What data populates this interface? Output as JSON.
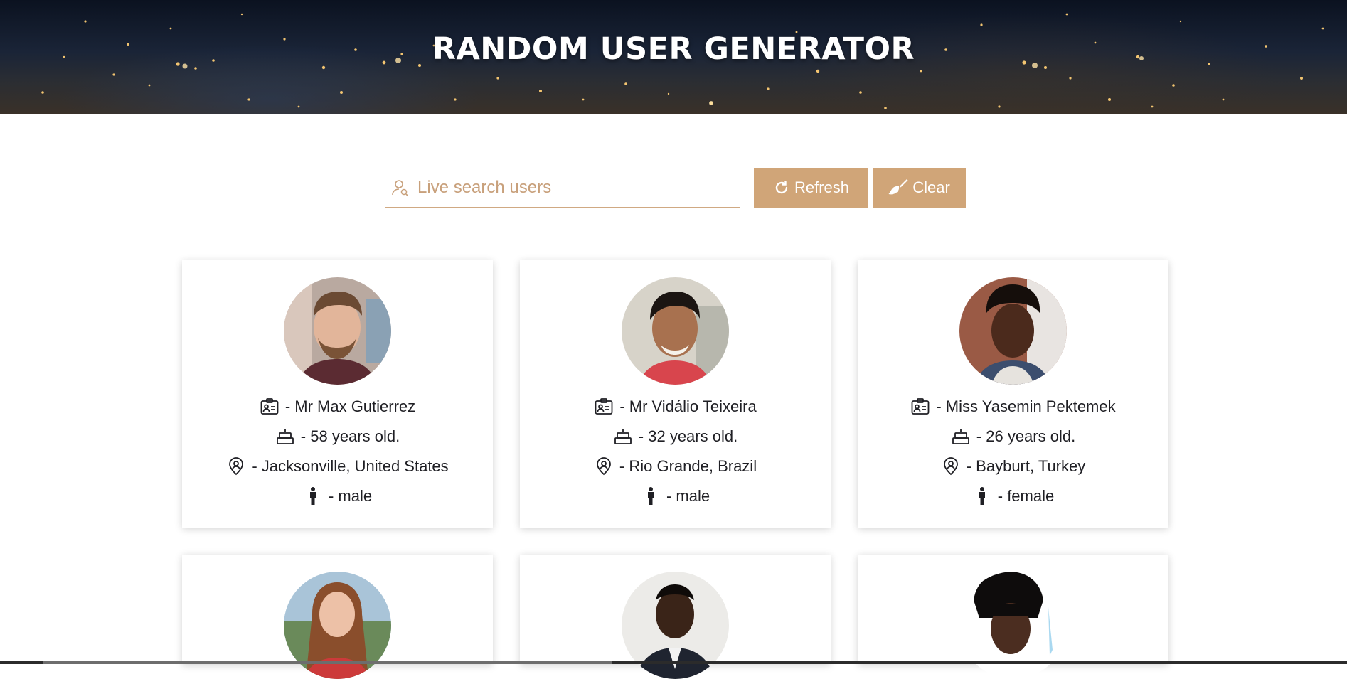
{
  "header": {
    "title": "RANDOM USER GENERATOR"
  },
  "search": {
    "placeholder": "Live search users",
    "value": ""
  },
  "buttons": {
    "refresh_label": "Refresh",
    "clear_label": "Clear"
  },
  "colors": {
    "accent": "#d0a578",
    "accent_text": "#c8a07b",
    "text": "#1f1f24"
  },
  "icons": {
    "name": "id-card-icon",
    "age": "cake-icon",
    "location": "map-pin-icon",
    "gender": "person-icon",
    "search": "user-search-icon",
    "refresh": "refresh-icon",
    "clear": "broom-icon"
  },
  "users": [
    {
      "name": "- Mr Max Gutierrez",
      "age": "- 58 years old.",
      "location": "- Jacksonville, United States",
      "gender": "- male"
    },
    {
      "name": "- Mr Vidálio Teixeira",
      "age": "- 32 years old.",
      "location": "- Rio Grande, Brazil",
      "gender": "- male"
    },
    {
      "name": "- Miss Yasemin Pektemek",
      "age": "- 26 years old.",
      "location": "- Bayburt, Turkey",
      "gender": "- female"
    }
  ]
}
